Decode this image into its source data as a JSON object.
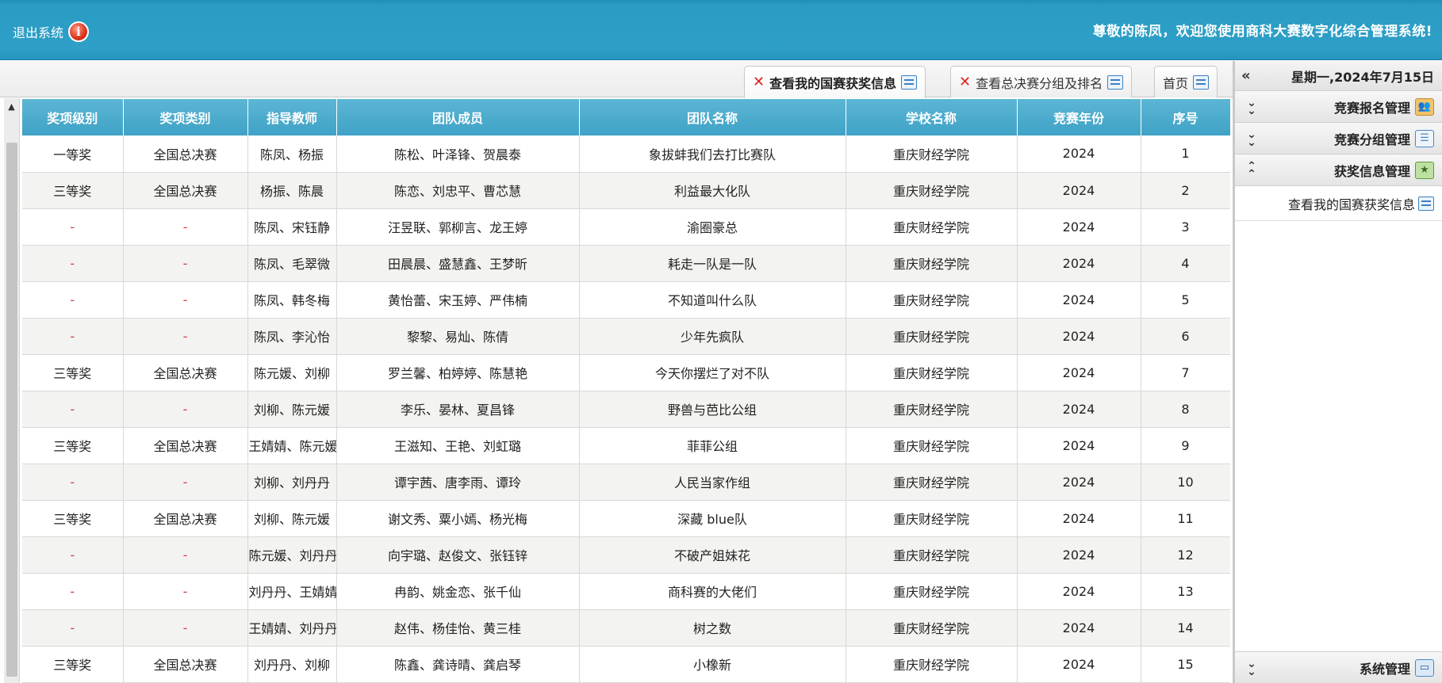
{
  "header": {
    "welcome": "尊敬的陈凤，欢迎您使用商科大赛数字化综合管理系统!",
    "logout_label": "退出系统"
  },
  "sidebar": {
    "date": "星期一,2024年7月15日",
    "groups": [
      {
        "label": "竞赛报名管理",
        "icon": "users-icon"
      },
      {
        "label": "竞赛分组管理",
        "icon": "list-icon"
      },
      {
        "label": "获奖信息管理",
        "icon": "award-icon"
      }
    ],
    "sub_item": "查看我的国赛获奖信息",
    "bottom_group": "系统管理"
  },
  "tabs": [
    {
      "label": "首页"
    },
    {
      "label": "查看总决赛分组及排名"
    },
    {
      "label": "查看我的国赛获奖信息"
    }
  ],
  "table": {
    "headers": [
      "序号",
      "竞赛年份",
      "学校名称",
      "团队名称",
      "团队成员",
      "指导教师",
      "奖项类别",
      "奖项级别"
    ],
    "rows": [
      [
        "1",
        "2024",
        "重庆财经学院",
        "象拔蚌我们去打比赛队",
        "陈松、叶泽锋、贺晨泰",
        "陈凤、杨振",
        "全国总决赛",
        "一等奖"
      ],
      [
        "2",
        "2024",
        "重庆财经学院",
        "利益最大化队",
        "陈恋、刘忠平、曹芯慧",
        "杨振、陈晨",
        "全国总决赛",
        "三等奖"
      ],
      [
        "3",
        "2024",
        "重庆财经学院",
        "渝圈豪总",
        "汪昱联、郭柳言、龙王婷",
        "陈凤、宋钰静",
        "-",
        "-"
      ],
      [
        "4",
        "2024",
        "重庆财经学院",
        "耗走一队是一队",
        "田晨晨、盛慧鑫、王梦昕",
        "陈凤、毛翠微",
        "-",
        "-"
      ],
      [
        "5",
        "2024",
        "重庆财经学院",
        "不知道叫什么队",
        "黄怡蕾、宋玉婷、严伟楠",
        "陈凤、韩冬梅",
        "-",
        "-"
      ],
      [
        "6",
        "2024",
        "重庆财经学院",
        "少年先疯队",
        "黎黎、易灿、陈倩",
        "陈凤、李沁怡",
        "-",
        "-"
      ],
      [
        "7",
        "2024",
        "重庆财经学院",
        "今天你摆烂了对不队",
        "罗兰馨、柏婷婷、陈慧艳",
        "陈元媛、刘柳",
        "全国总决赛",
        "三等奖"
      ],
      [
        "8",
        "2024",
        "重庆财经学院",
        "野兽与芭比公组",
        "李乐、晏林、夏昌锋",
        "刘柳、陈元媛",
        "-",
        "-"
      ],
      [
        "9",
        "2024",
        "重庆财经学院",
        "菲菲公组",
        "王滋知、王艳、刘虹璐",
        "王婧婧、陈元媛",
        "全国总决赛",
        "三等奖"
      ],
      [
        "10",
        "2024",
        "重庆财经学院",
        "人民当家作组",
        "谭宇茜、唐李雨、谭玲",
        "刘柳、刘丹丹",
        "-",
        "-"
      ],
      [
        "11",
        "2024",
        "重庆财经学院",
        "深藏 blue队",
        "谢文秀、粟小嫣、杨光梅",
        "刘柳、陈元媛",
        "全国总决赛",
        "三等奖"
      ],
      [
        "12",
        "2024",
        "重庆财经学院",
        "不破产姐妹花",
        "向宇璐、赵俊文、张钰锌",
        "陈元媛、刘丹丹",
        "-",
        "-"
      ],
      [
        "13",
        "2024",
        "重庆财经学院",
        "商科赛的大佬们",
        "冉韵、姚金恋、张千仙",
        "刘丹丹、王婧婧",
        "-",
        "-"
      ],
      [
        "14",
        "2024",
        "重庆财经学院",
        "树之数",
        "赵伟、杨佳怡、黄三桂",
        "王婧婧、刘丹丹",
        "-",
        "-"
      ],
      [
        "15",
        "2024",
        "重庆财经学院",
        "小橡新",
        "陈鑫、龚诗晴、龚启琴",
        "刘丹丹、刘柳",
        "全国总决赛",
        "三等奖"
      ]
    ]
  },
  "colors": {
    "header_bg": "#2e9fc6",
    "table_header_bg": "#4aa8cb",
    "close_x": "#e02020",
    "dash": "#d53a3a"
  }
}
